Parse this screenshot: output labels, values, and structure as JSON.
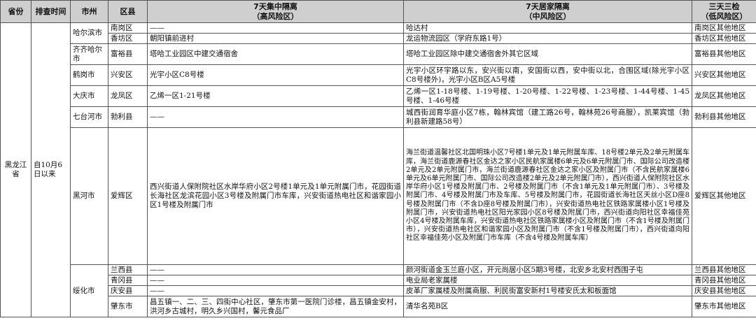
{
  "headers": {
    "province": "省份",
    "time": "排查时间",
    "city": "市州",
    "district": "区县",
    "central": "7天集中隔离",
    "central_sub": "（高风险区）",
    "home": "7天居家隔离",
    "home_sub": "（中风险区）",
    "check": "三天三检",
    "check_sub": "（低风险区）"
  },
  "province": "黑龙江省",
  "time": "自10月6日以来",
  "rows": [
    {
      "city": "哈尔滨市",
      "district": "南岗区",
      "central": "——",
      "home": "哈达村",
      "check": "南岗区其他地区"
    },
    {
      "district": "香坊区",
      "central": "朝阳镇前进村",
      "home": "龙运物流园区（学府东路1号）",
      "check": "香坊区其他地区"
    },
    {
      "city": "齐齐哈尔市",
      "district": "富裕县",
      "central": "塔哈工业园区中建交通宿舍",
      "home": "塔哈工业园区除中建交通宿舍外其它区域",
      "check": "富裕县其他地区"
    },
    {
      "city": "鹤岗市",
      "district": "兴安区",
      "central": "光宇小区C8号楼",
      "home": "光宇小区环宇路以东，安兴街以南，安国街以西，安中街以北，合围区域(除光宇小区C8号楼外)，光宇小区B区A5号楼",
      "check": "兴安区其他地区"
    },
    {
      "city": "大庆市",
      "district": "龙凤区",
      "central": "乙烯一区1-21号楼",
      "home": "乙烯一区1-18号楼、1-19号楼、1-20号楼、1-22号楼、1-23号楼、1-44号楼、1-45号楼、1-46号楼",
      "check": "龙凤区其他地区"
    },
    {
      "city": "七台河市",
      "district": "勃利县",
      "central": "——",
      "home": "城西街润育华庭小区7栋，翰林宾馆（建工路26号，翰林苑26号商服），凯莱宾馆（勃利县新建路58号）",
      "check": "勃利县其他地区"
    },
    {
      "city": "黑河市",
      "district": "爱辉区",
      "central": "西兴街道人保附院社区水岸华府小区2号楼1单元及1单元附属门市，花园街道长海社区龙滨花园小区3号楼及附属门市车库，兴安街道热电社区和谐家园小区1号楼及附属门市",
      "home": "海兰街道温馨社区北国明珠小区7号楼1单元及1单元附属车库、18号楼2单元及2单元附属车库，海兰街道鹿源春社区金达之家小区民航家属楼6单元及6单元附属门市、国际公司改造楼2单元及2单元附属门市，海兰街道鹿源春社区金达之家小区及附属门市（不含民航家属楼6单元及6单元附属门市、国际公司改造楼2单元及2单元附属门市），西兴街道人保附院社区水岸华府小区1号楼及附属门市、2号楼及附属门市（不含1单元及1单元附属门市）、3号楼及附属门市、4号楼及附属门市及车库、5号楼及附属门市，花园街道长海社区天丝小区D座8号楼及附属门市（不含D座8号楼及附属门市），兴安街道热电社区铁路家属楼小区1号楼及附属门市，兴安街道热电社区阳光家园小区8号楼及附属门市，西兴街道向阳社区幸福佳苑小区4号楼及附属车库，兴安街道热电社区铁路家属楼小区及附属门市（不含1号楼及附属门市），兴安街道热电社区和谐家园小区及附属门市（不含1号楼及附属门市），西兴街道向阳社区幸福佳苑小区及附属门市车库（不含4号楼及附属车库）",
      "check": "爱辉区其他地区"
    },
    {
      "city": "绥化市",
      "district": "兰西县",
      "central": "——",
      "home": "颜河街道金玉兰庭小区，开元尚居小区5期3号楼，北安乡北安村西围子屯",
      "check": "兰西县其他地区"
    },
    {
      "district": "青冈县",
      "central": "——",
      "home": "电业局老家属楼",
      "check": "青冈县其他地区"
    },
    {
      "district": "庆安县",
      "central": "——",
      "home": "皮革厂家属楼及附属商服、利民街富安新村1号楼安氏太和板面馆",
      "check": "庆安县其他地区"
    },
    {
      "district": "肇东市",
      "central": "昌五镇一、二、三、四街中心社区，肇东市第一医院门诊楼，昌五镇金安村，洪河乡古城村，明久乡兴国村，馨元食品厂",
      "home": "清华名苑B区",
      "check": "肇东市其他地区"
    }
  ]
}
